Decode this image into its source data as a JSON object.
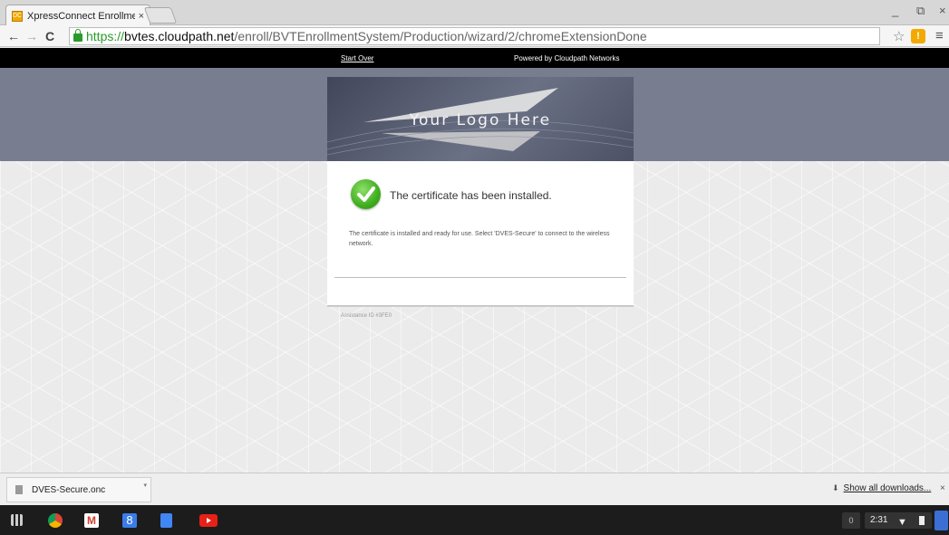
{
  "browser": {
    "tab_title": "XpressConnect Enrollme",
    "tab_close": "×",
    "favicon_label": "DC",
    "window_controls": [
      "_",
      "⧉",
      "×"
    ],
    "nav": {
      "back": "←",
      "forward": "→",
      "reload": "C"
    },
    "url": {
      "scheme": "https://",
      "host": "bvtes.cloudpath.net",
      "path": "/enroll/BVTEnrollmentSystem/Production/wizard/2/chromeExtensionDone"
    },
    "bookmark_star": "☆",
    "menu_icon": "≡"
  },
  "page": {
    "start_over": "Start Over",
    "powered_by": "Powered by Cloudpath Networks",
    "logo_text": "Your Logo Here",
    "heading": "The certificate has been installed.",
    "body": "The certificate is installed and ready for use. Select 'DVES-Secure' to connect to the wireless network.",
    "assistance_id": "Assistance ID #3FE0"
  },
  "downloads": {
    "file_name": "DVES-Secure.onc",
    "dropdown": "▾",
    "show_all": "Show all downloads...",
    "show_all_icon": "⬇",
    "close": "×"
  },
  "shelf": {
    "gplus_label": "8",
    "notification_count": "0",
    "time": "2:31",
    "wifi": "▼"
  },
  "colors": {
    "header_band": "#787d8f",
    "secure_green": "#2a9a2a",
    "accent_orange": "#f2a900"
  }
}
